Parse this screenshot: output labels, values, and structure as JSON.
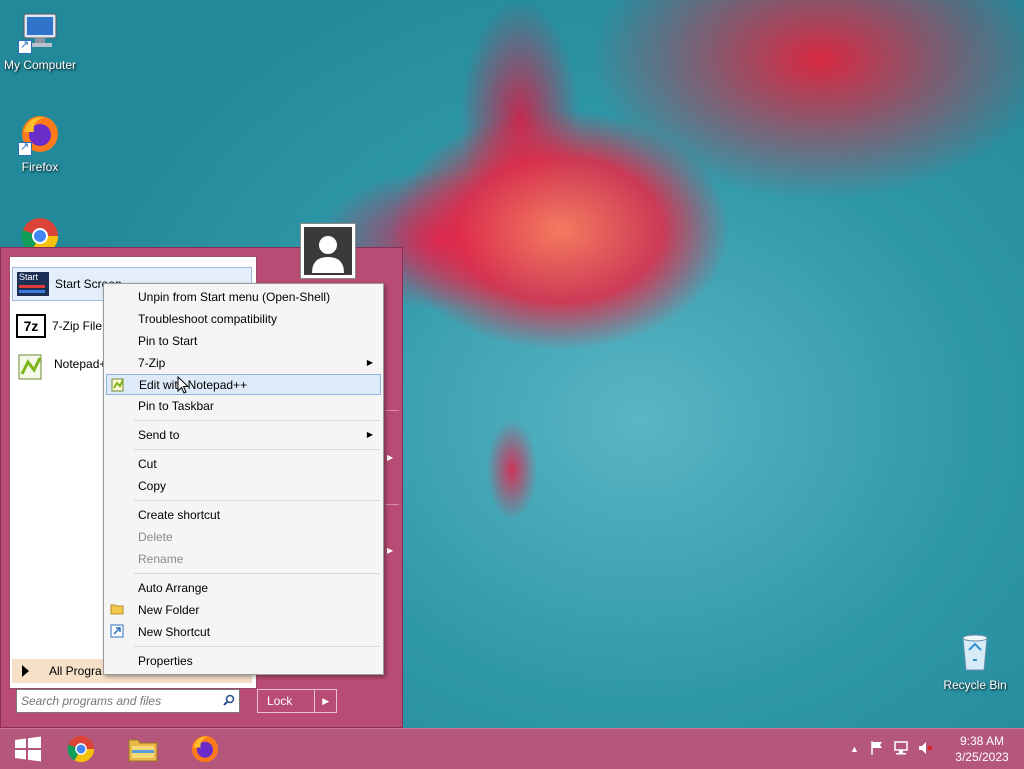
{
  "desktop": {
    "icons": [
      {
        "label": "My Computer",
        "icon": "computer-icon"
      },
      {
        "label": "Firefox",
        "icon": "firefox-icon"
      },
      {
        "label": "Recycle Bin",
        "icon": "recycle-bin-icon"
      }
    ]
  },
  "start_menu": {
    "programs": [
      {
        "label": "Start Screen",
        "icon": "start-screen-icon",
        "icon_text": "Start"
      },
      {
        "label": "7-Zip File",
        "icon": "7zip-icon",
        "icon_text": "7z"
      },
      {
        "label": "Notepad+",
        "icon": "notepadpp-icon"
      }
    ],
    "all_programs": "All Progra",
    "search_placeholder": "Search programs and files",
    "lock_label": "Lock"
  },
  "context_menu": {
    "items": [
      {
        "label": "Unpin from Start menu (Open-Shell)"
      },
      {
        "label": "Troubleshoot compatibility"
      },
      {
        "label": "Pin to Start"
      },
      {
        "label": "7-Zip",
        "submenu": true
      },
      {
        "label": "Edit with Notepad++",
        "highlighted": true,
        "icon": "notepadpp-icon"
      },
      {
        "label": "Pin to Taskbar"
      },
      {
        "label": "Send to",
        "submenu": true
      },
      {
        "label": "Cut"
      },
      {
        "label": "Copy"
      },
      {
        "label": "Create shortcut"
      },
      {
        "label": "Delete",
        "disabled": true
      },
      {
        "label": "Rename",
        "disabled": true
      },
      {
        "label": "Auto Arrange"
      },
      {
        "label": "New Folder",
        "icon": "folder-icon"
      },
      {
        "label": "New Shortcut",
        "icon": "shortcut-icon"
      },
      {
        "label": "Properties"
      }
    ]
  },
  "taskbar": {
    "time": "9:38 AM",
    "date": "3/25/2023"
  },
  "colors": {
    "start_menu": "#b94c74",
    "taskbar": "#b5577c",
    "highlight": "#dfeaf8"
  }
}
